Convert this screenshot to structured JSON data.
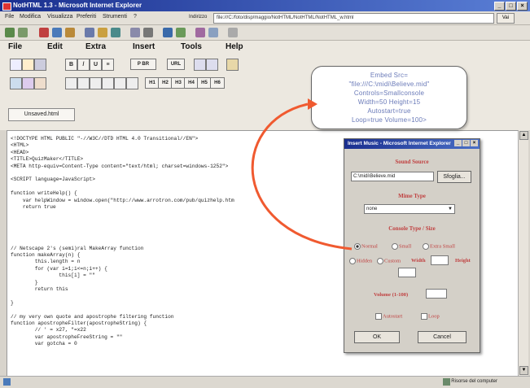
{
  "window": {
    "title": "NotHTML 1.3 - Microsoft Internet Explorer",
    "min": "_",
    "max": "□",
    "close": "×"
  },
  "ie_menu": {
    "items": [
      "File",
      "Modifica",
      "Visualizza",
      "Preferiti",
      "Strumenti",
      "?"
    ],
    "address_label": "Indirizzo",
    "address": "file:///C:/foto/disp/maggio/NotHTML/NotHTML/NotHTML_w.html",
    "go": "Vai"
  },
  "app_menu": {
    "items": [
      "File",
      "Edit",
      "Extra",
      "Insert",
      "Tools",
      "Help"
    ]
  },
  "toolbar1": {
    "format": [
      "B",
      "/",
      "U",
      "≡"
    ],
    "p_br": "P BR",
    "url": "URL"
  },
  "toolbar2": {
    "headings": [
      "H1",
      "H2",
      "H3",
      "H4",
      "H5",
      "H6"
    ]
  },
  "tab": {
    "label": "Unsaved.html"
  },
  "editor": {
    "lines": [
      "<!DOCTYPE HTML PUBLIC \"-//W3C//DTD HTML 4.0 Transitional//EN\">",
      "<HTML>",
      "<HEAD>",
      "<TITLE>QuizMaker</TITLE>",
      "<META http-equiv=Content-Type content=\"text/html; charset=windows-1252\">",
      "",
      "<SCRIPT language=JavaScript>",
      "",
      "function writeHelp() {",
      "    var helpWindow = window.open(\"http://www.arrotron.com/pub/quizhelp.htm",
      "    return true",
      "",
      "",
      "",
      "",
      "",
      "// Netscape 2's (semi)ral MakeArray function",
      "function makeArray(n) {",
      "        this.length = n",
      "        for (var i=1;i<=n;i++) {",
      "                this[i] = \"\"",
      "        }",
      "        return this",
      "",
      "}",
      "",
      "// my very own quote and apostrophe filtering function",
      "function apostropheFilter(apostropheString) {",
      "        // ' = x27, \"=x22",
      "        var apostropheFreeString = \"\"",
      "        var gotcha = 0"
    ]
  },
  "callout": {
    "lines": [
      "Embed Src=",
      "\"file:///C:\\midi\\Believe.mid\"",
      "Controls=Smallconsole",
      "Width=50 Height=15",
      "Autostart=true",
      "Loop=true Volume=100>"
    ],
    "arrow_color": "#f05a30"
  },
  "dialog": {
    "title": "Insert Music - Microsoft Internet Explorer",
    "sound_source_label": "Sound Source",
    "sound_source_value": "C:\\midi\\Believe.mid",
    "browse_label": "Sfoglia...",
    "mime_label": "Mime Type",
    "mime_value": "none",
    "console_label": "Console Type / Size",
    "console_options": [
      "Normal",
      "Small",
      "Extra Small"
    ],
    "hidden_label": "Hidden",
    "custom_label": "Custom",
    "width_label": "Width",
    "height_label": "Height",
    "volume_label": "Volume (1-100)",
    "autostart_label": "Autostart",
    "loop_label": "Loop",
    "ok_label": "OK",
    "cancel_label": "Cancel"
  },
  "status": {
    "text": "Risorse del computer"
  }
}
